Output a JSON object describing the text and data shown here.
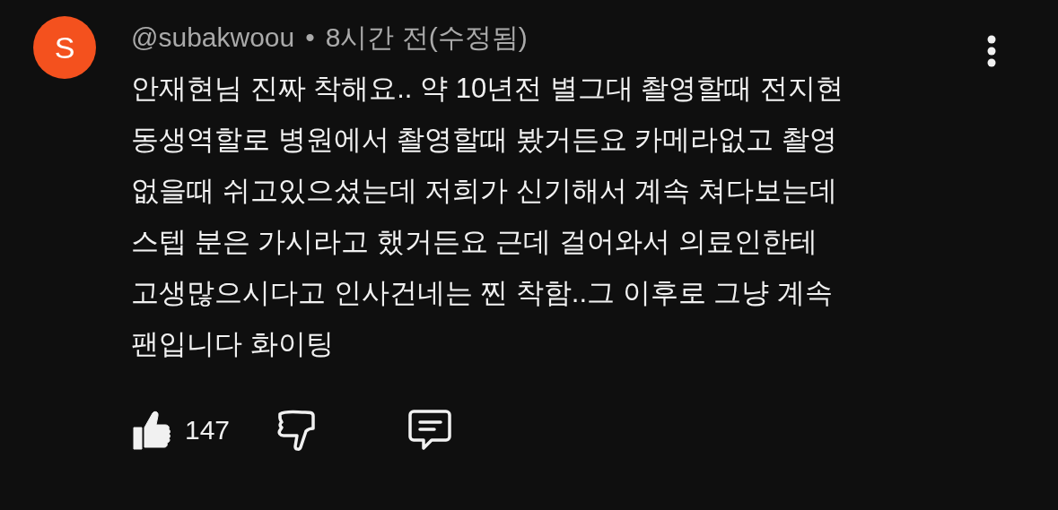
{
  "comment": {
    "avatar_letter": "S",
    "author": "@subakwoou",
    "separator": "•",
    "time": "8시간 전(수정됨)",
    "text_lines": [
      "안재현님 진짜 착해요.. 약 10년전 별그대 촬영할때 전지현",
      "동생역할로 병원에서 촬영할때 봤거든요 카메라없고 촬영",
      "없을때 쉬고있으셨는데 저희가 신기해서 계속 쳐다보는데",
      "스텝 분은 가시라고 했거든요 근데 걸어와서 의료인한테",
      "고생많으시다고 인사건네는 찐 착함..그 이후로 그냥 계속",
      "팬입니다 화이팅"
    ],
    "like_count": "147",
    "liked": true,
    "disliked": false
  }
}
